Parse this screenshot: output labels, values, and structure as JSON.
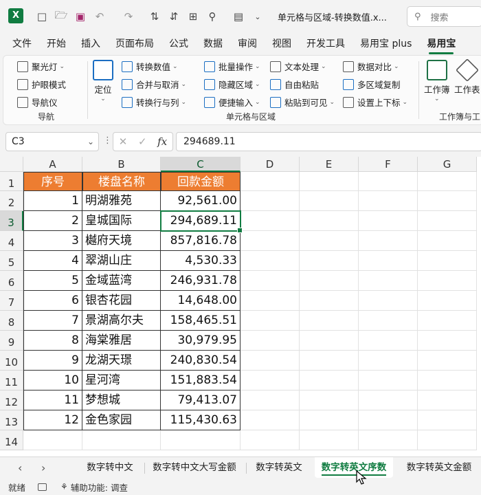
{
  "app": {
    "title": "单元格与区域-转换数值.x...",
    "search_placeholder": "搜索"
  },
  "ribbon_tabs": [
    "文件",
    "开始",
    "插入",
    "页面布局",
    "公式",
    "数据",
    "审阅",
    "视图",
    "开发工具",
    "易用宝 plus",
    "易用宝"
  ],
  "active_tab_index": 10,
  "ribbon": {
    "nav_group": {
      "items": [
        "聚光灯",
        "护眼模式",
        "导航仪"
      ],
      "label": "导航"
    },
    "locate": "定位",
    "cells_group": {
      "col1": [
        "转换数值",
        "合并与取消",
        "转换行与列"
      ],
      "col2": [
        "批量操作",
        "隐藏区域",
        "便捷输入"
      ],
      "col3": [
        "文本处理",
        "自由粘贴",
        "粘贴到可见"
      ],
      "col4": [
        "数据对比",
        "多区域复制",
        "设置上下标"
      ],
      "label": "单元格与区域"
    },
    "wb_group": {
      "items": [
        "工作簿",
        "工作表"
      ],
      "label": "工作簿与工"
    }
  },
  "formula_bar": {
    "name_box": "C3",
    "value": "294689.11"
  },
  "columns": [
    "A",
    "B",
    "C",
    "D",
    "E",
    "F",
    "G"
  ],
  "rows": [
    "1",
    "2",
    "3",
    "4",
    "5",
    "6",
    "7",
    "8",
    "9",
    "10",
    "11",
    "12",
    "13",
    "14"
  ],
  "table": {
    "headers": [
      "序号",
      "楼盘名称",
      "回款金额"
    ],
    "rows": [
      [
        "1",
        "明湖雅苑",
        "92,561.00"
      ],
      [
        "2",
        "皇城国际",
        "294,689.11"
      ],
      [
        "3",
        "樾府天境",
        "857,816.78"
      ],
      [
        "4",
        "翠湖山庄",
        "4,530.33"
      ],
      [
        "5",
        "金域蓝湾",
        "246,931.78"
      ],
      [
        "6",
        "银杏花园",
        "14,648.00"
      ],
      [
        "7",
        "景湖高尔夫",
        "158,465.51"
      ],
      [
        "8",
        "海棠雅居",
        "30,979.95"
      ],
      [
        "9",
        "龙湖天璟",
        "240,830.54"
      ],
      [
        "10",
        "星河湾",
        "151,883.54"
      ],
      [
        "11",
        "梦想城",
        "79,413.07"
      ],
      [
        "12",
        "金色家园",
        "115,430.63"
      ]
    ]
  },
  "sheets": [
    "数字转中文",
    "数字转中文大写金额",
    "数字转英文",
    "数字转英文序数",
    "数字转英文金额"
  ],
  "active_sheet_index": 3,
  "status": {
    "ready": "就绪",
    "accessibility": "辅助功能: 调查"
  },
  "colors": {
    "accent": "#107c41",
    "header_fill": "#ed7d31"
  }
}
